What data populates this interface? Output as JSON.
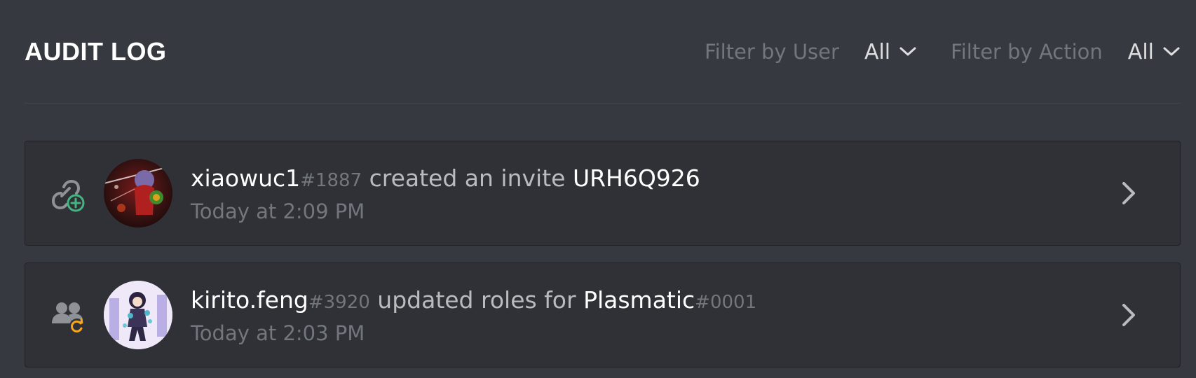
{
  "header": {
    "title": "AUDIT LOG",
    "filter_user": {
      "label": "Filter by User",
      "value": "All"
    },
    "filter_action": {
      "label": "Filter by Action",
      "value": "All"
    }
  },
  "entries": [
    {
      "user": "xiaowuc1",
      "discriminator": "#1887",
      "action": " created an invite ",
      "target": "URH6Q926",
      "target_discriminator": "",
      "timestamp": "Today at 2:09 PM",
      "icon": "invite-create-icon",
      "icon_accent": "#43b581"
    },
    {
      "user": "kirito.feng",
      "discriminator": "#3920",
      "action": " updated roles for ",
      "target": "Plasmatic",
      "target_discriminator": "#0001",
      "timestamp": "Today at 2:03 PM",
      "icon": "member-role-update-icon",
      "icon_accent": "#faa61a"
    }
  ]
}
